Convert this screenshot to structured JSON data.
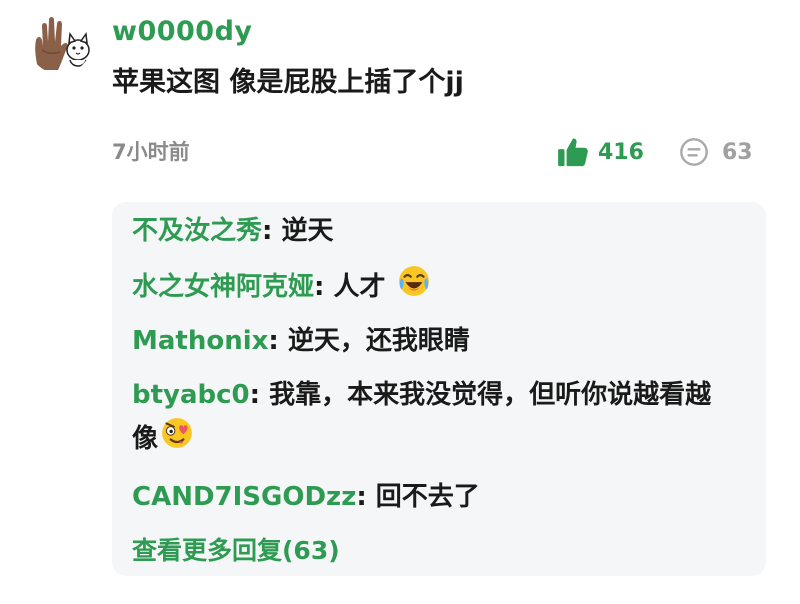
{
  "comment": {
    "username": "w0000dy",
    "text": "苹果这图 像是屁股上插了个jj",
    "timestamp": "7小时前",
    "likes": "416",
    "reply_count": "63"
  },
  "replies": [
    {
      "author": "不及汝之秀",
      "sep": ": ",
      "text": "逆天"
    },
    {
      "author": "水之女神阿克娅",
      "sep": ": ",
      "text": "人才"
    },
    {
      "author": "Mathonix",
      "sep": ": ",
      "text": "逆天，还我眼睛"
    },
    {
      "author": "btyabc0",
      "sep": ": ",
      "text": "我靠，本来我没觉得，但听你说越看越",
      "text_cont": "像"
    },
    {
      "author": "CAND7ISGODzz",
      "sep": ": ",
      "text": "回不去了"
    }
  ],
  "more_replies_label": "查看更多回复(63)",
  "icons": {
    "avatar": "hand-cat-avatar",
    "like": "thumbs-up-icon",
    "reply": "comment-icon",
    "reply_emoji_1": "laughing-crying-emoji",
    "reply_emoji_2": "heart-eyes-emoji"
  },
  "colors": {
    "accent_green": "#2e9b52",
    "muted_gray": "#8a8a8a",
    "reply_bg": "#f5f6f7"
  }
}
